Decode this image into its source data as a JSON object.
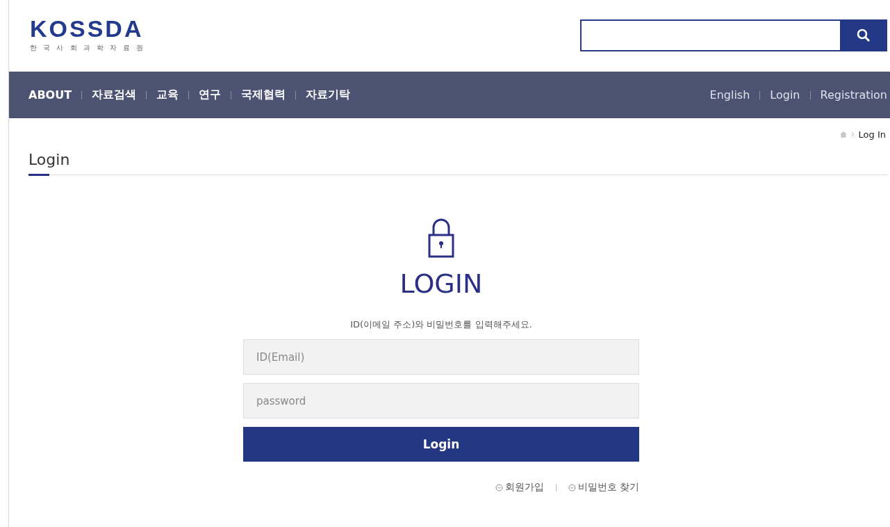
{
  "header": {
    "logo": "KOSSDA",
    "logo_subtitle": "한 국 사 회 과 학 자 료 원"
  },
  "nav": {
    "items": [
      "ABOUT",
      "자료검색",
      "교육",
      "연구",
      "국제협력",
      "자료기탁"
    ],
    "utility": [
      "English",
      "Login",
      "Registration"
    ]
  },
  "breadcrumb": {
    "current": "Log In"
  },
  "page_title": "Login",
  "login": {
    "heading": "LOGIN",
    "instruction": "ID(이메일 주소)와 비밀번호를 입력해주세요.",
    "id_field": {
      "placeholder": "ID(Email)"
    },
    "password_field": {
      "placeholder": "password"
    },
    "submit": "Login",
    "links": [
      "회원가입",
      "비밀번호 찾기"
    ]
  }
}
